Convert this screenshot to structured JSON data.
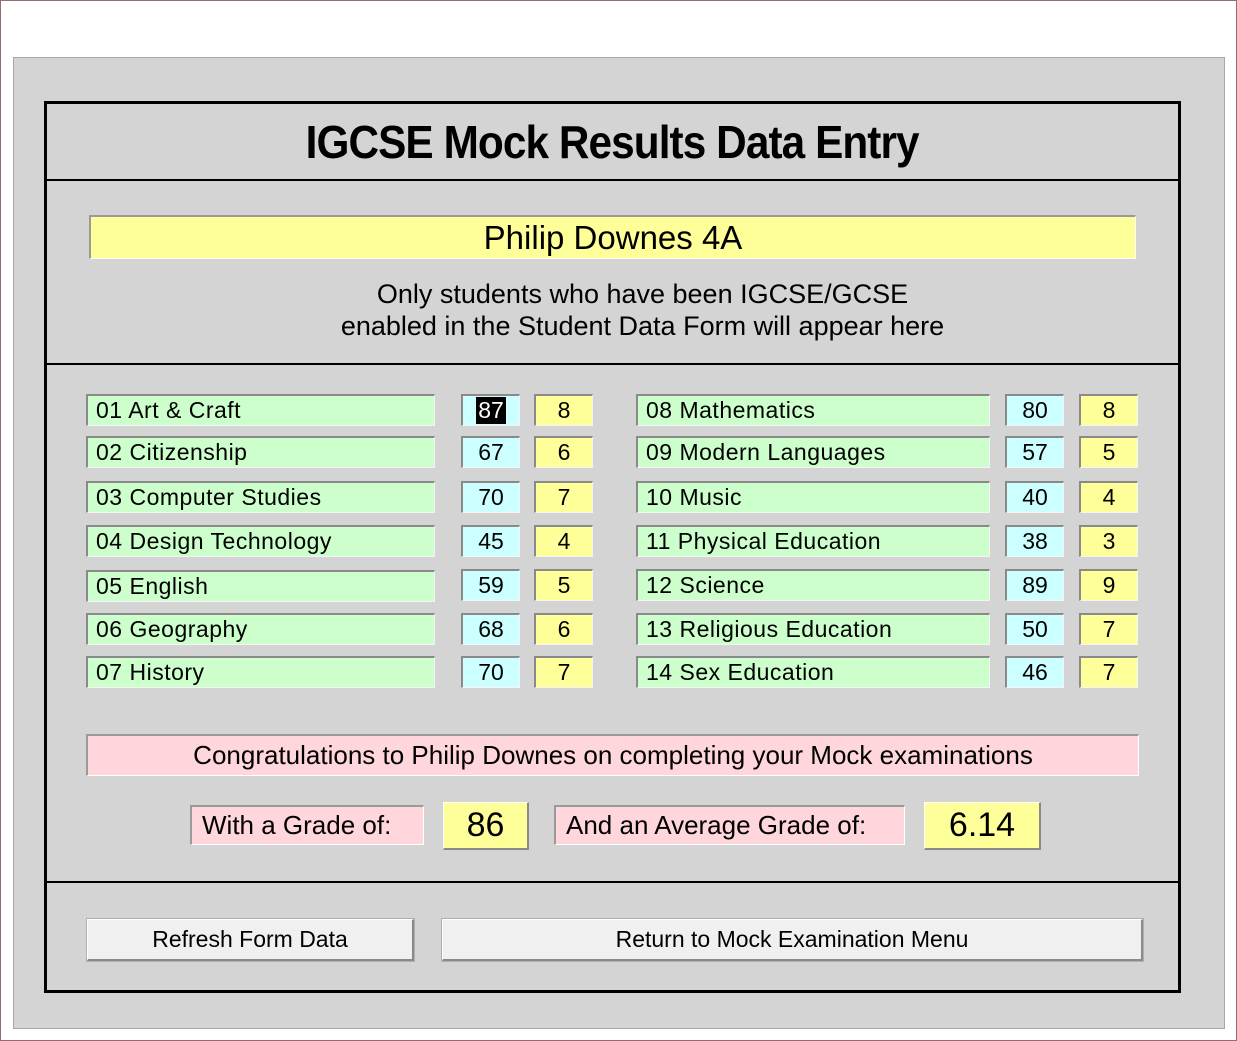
{
  "title": "IGCSE Mock Results Data Entry",
  "student": {
    "name": "Philip Downes 4A"
  },
  "note": {
    "line1": "Only students who have been IGCSE/GCSE",
    "line2": "enabled in the Student Data Form will appear here"
  },
  "subjects_left": [
    {
      "subject": "01 Art & Craft",
      "mark": "87",
      "grade": "8"
    },
    {
      "subject": "02 Citizenship",
      "mark": "67",
      "grade": "6"
    },
    {
      "subject": "03 Computer Studies",
      "mark": "70",
      "grade": "7"
    },
    {
      "subject": "04 Design Technology",
      "mark": "45",
      "grade": "4"
    },
    {
      "subject": "05 English",
      "mark": "59",
      "grade": "5"
    },
    {
      "subject": "06 Geography",
      "mark": "68",
      "grade": "6"
    },
    {
      "subject": "07 History",
      "mark": "70",
      "grade": "7"
    }
  ],
  "subjects_right": [
    {
      "subject": "08 Mathematics",
      "mark": "80",
      "grade": "8"
    },
    {
      "subject": "09 Modern Languages",
      "mark": "57",
      "grade": "5"
    },
    {
      "subject": "10 Music",
      "mark": "40",
      "grade": "4"
    },
    {
      "subject": "11 Physical Education",
      "mark": "38",
      "grade": "3"
    },
    {
      "subject": "12 Science",
      "mark": "89",
      "grade": "9"
    },
    {
      "subject": "13 Religious Education",
      "mark": "50",
      "grade": "7"
    },
    {
      "subject": "14 Sex Education",
      "mark": "46",
      "grade": "7"
    }
  ],
  "summary": {
    "congrats": "Congratulations to Philip Downes on completing your Mock examinations",
    "grade_label": "With a Grade of:",
    "grade_value": "86",
    "average_label": "And an Average Grade of:",
    "average_value": "6.14"
  },
  "buttons": {
    "refresh": "Refresh Form Data",
    "return": "Return to Mock Examination Menu"
  }
}
